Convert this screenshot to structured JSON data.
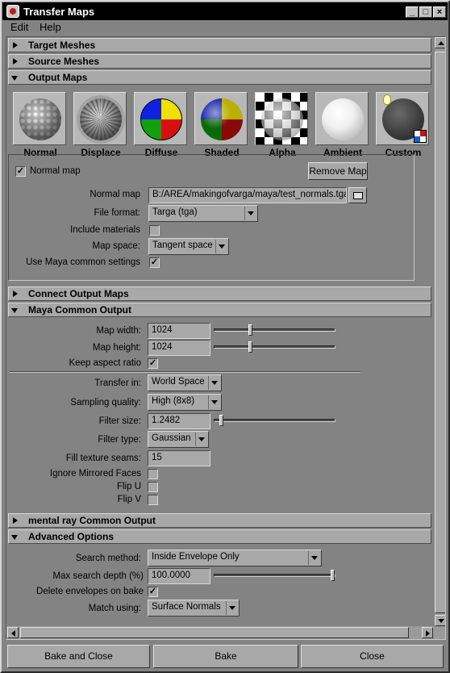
{
  "window": {
    "title": "Transfer Maps"
  },
  "menu": {
    "items": [
      "Edit",
      "Help"
    ]
  },
  "sections": {
    "target_meshes": "Target Meshes",
    "source_meshes": "Source Meshes",
    "output_maps": "Output Maps",
    "connect_output_maps": "Connect Output Maps",
    "maya_common_output": "Maya Common Output",
    "mental_ray_common_output": "mental ray Common Output",
    "advanced_options": "Advanced Options"
  },
  "map_types": [
    "Normal",
    "Displace",
    "Diffuse",
    "Shaded",
    "Alpha",
    "Ambient",
    "Custom"
  ],
  "output": {
    "normal_map_check_label": "Normal map",
    "normal_map_checked": true,
    "remove_map_label": "Remove Map",
    "normal_map_label": "Normal map",
    "normal_map_value": "B:/AREA/makingofvarga/maya/test_normals.tga",
    "file_format_label": "File format:",
    "file_format_value": "Targa (tga)",
    "include_materials_label": "Include materials",
    "include_materials_checked": false,
    "map_space_label": "Map space:",
    "map_space_value": "Tangent space",
    "use_maya_common_label": "Use Maya common settings",
    "use_maya_common_checked": true
  },
  "maya_common": {
    "map_width_label": "Map width:",
    "map_width_value": "1024",
    "map_height_label": "Map height:",
    "map_height_value": "1024",
    "keep_aspect_label": "Keep aspect ratio",
    "keep_aspect_checked": true,
    "transfer_in_label": "Transfer in:",
    "transfer_in_value": "World Space",
    "sampling_quality_label": "Sampling quality:",
    "sampling_quality_value": "High (8x8)",
    "filter_size_label": "Filter size:",
    "filter_size_value": "1.2482",
    "filter_type_label": "Filter type:",
    "filter_type_value": "Gaussian",
    "fill_seams_label": "Fill texture seams:",
    "fill_seams_value": "15",
    "ignore_mirrored_label": "Ignore Mirrored Faces",
    "ignore_mirrored_checked": false,
    "flip_u_label": "Flip U",
    "flip_u_checked": false,
    "flip_v_label": "Flip V",
    "flip_v_checked": false,
    "map_width_slider_fraction": 0.29,
    "map_height_slider_fraction": 0.29,
    "filter_size_slider_fraction": 0.04
  },
  "advanced": {
    "search_method_label": "Search method:",
    "search_method_value": "Inside Envelope Only",
    "max_search_depth_label": "Max search depth (%)",
    "max_search_depth_value": "100.0000",
    "max_search_depth_slider_fraction": 1.0,
    "delete_envelopes_label": "Delete envelopes on bake",
    "delete_envelopes_checked": true,
    "match_using_label": "Match using:",
    "match_using_value": "Surface Normals"
  },
  "buttons": {
    "bake_and_close": "Bake and Close",
    "bake": "Bake",
    "close": "Close"
  }
}
